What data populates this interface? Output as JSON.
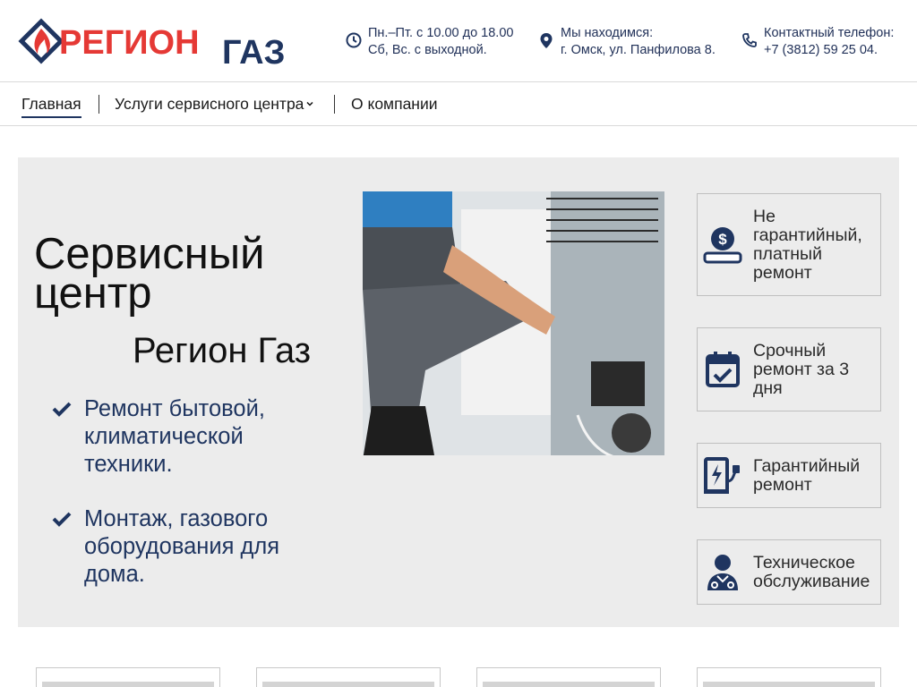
{
  "brand": {
    "logo_text_part1": "РЕГИОН",
    "logo_text_part2": "ГАЗ",
    "color_red": "#e53935",
    "color_navy": "#1f3560"
  },
  "header": {
    "hours": {
      "icon": "clock-icon",
      "line1": "Пн.–Пт. с 10.00 до 18.00",
      "line2": "Сб, Вс. с выходной."
    },
    "location": {
      "icon": "map-pin-icon",
      "line1": "Мы находимся:",
      "line2": "г. Омск, ул. Панфилова 8."
    },
    "phone": {
      "icon": "phone-icon",
      "line1": "Контактный телефон:",
      "line2": "+7 (3812) 59 25 04."
    }
  },
  "nav": {
    "items": [
      {
        "label": "Главная",
        "active": true
      },
      {
        "label": "Услуги сервисного центра",
        "has_dropdown": true
      },
      {
        "label": "О компании"
      }
    ]
  },
  "hero": {
    "title": "Сервисный центр",
    "subtitle": "Регион Газ",
    "bullets": [
      "Ремонт бытовой, климатической техники.",
      "Монтаж, газового оборудования для дома."
    ],
    "photo_icon": "technician-repairing-fridge-photo",
    "cards": [
      {
        "icon": "dollar-hand-icon",
        "label": "Не гарантийный, платный ремонт"
      },
      {
        "icon": "calendar-check-icon",
        "label": "Срочный ремонт за 3 дня"
      },
      {
        "icon": "charger-plug-icon",
        "label": "Гарантийный ремонт"
      },
      {
        "icon": "doctor-icon",
        "label": "Техническое обслуживание"
      }
    ]
  }
}
